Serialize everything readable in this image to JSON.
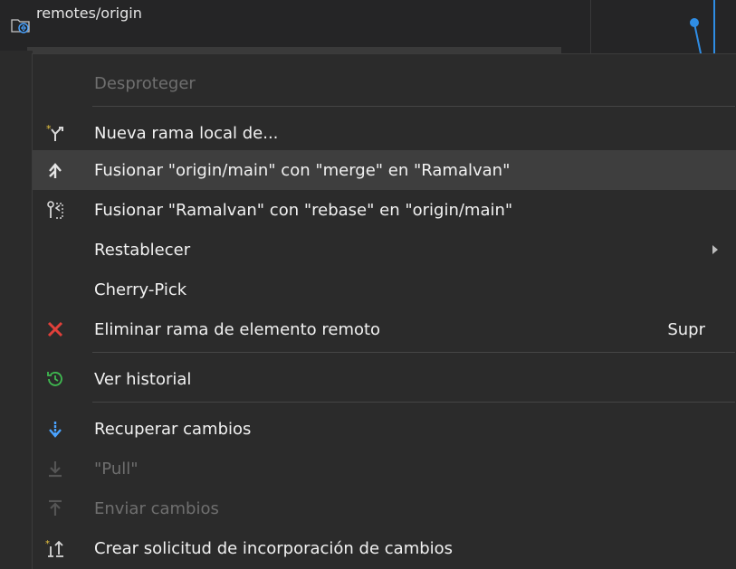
{
  "tree": {
    "node_label": "remotes/origin"
  },
  "menu": {
    "items": [
      {
        "label": "Desproteger"
      },
      {
        "label": "Nueva rama local de..."
      },
      {
        "label": "Fusionar \"origin/main\" con \"merge\" en \"Ramalvan\""
      },
      {
        "label": "Fusionar \"Ramalvan\" con \"rebase\" en \"origin/main\""
      },
      {
        "label": "Restablecer"
      },
      {
        "label": "Cherry-Pick"
      },
      {
        "label": "Eliminar rama de elemento remoto",
        "shortcut": "Supr"
      },
      {
        "label": "Ver historial"
      },
      {
        "label": "Recuperar cambios"
      },
      {
        "label": "\"Pull\""
      },
      {
        "label": "Enviar cambios"
      },
      {
        "label": "Crear solicitud de incorporación de cambios"
      }
    ]
  },
  "colors": {
    "accent_blue": "#2f8de4",
    "delete_red": "#e0403a",
    "history_green": "#3fb950",
    "star_yellow": "#e8c440"
  }
}
